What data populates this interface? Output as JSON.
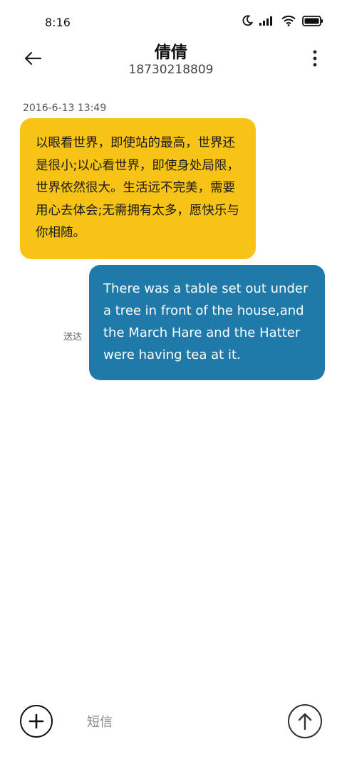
{
  "status_bar": {
    "time": "8:16",
    "icons": [
      "moon-icon",
      "signal-icon",
      "wifi-icon",
      "battery-icon"
    ]
  },
  "header": {
    "back_icon": "arrow-left-icon",
    "contact_name": "倩倩",
    "contact_number": "18730218809",
    "more_icon": "more-vertical-icon"
  },
  "conversation": {
    "timestamp": "2016-6-13 13:49",
    "messages": [
      {
        "direction": "received",
        "text": "以眼看世界，即使站的最高，世界还是很小;以心看世界，即使身处局限，世界依然很大。生活远不完美，需要用心去体会;无需拥有太多，愿快乐与你相随。",
        "color": "#f6c316"
      },
      {
        "direction": "sent",
        "text": "There was a table set out under a tree in front of the house,and the March Hare and the Hatter were having tea at it.",
        "status": "送达",
        "color": "#1f7aaa"
      }
    ]
  },
  "composer": {
    "add_icon": "plus-icon",
    "placeholder": "短信",
    "value": "",
    "send_icon": "arrow-up-icon"
  }
}
